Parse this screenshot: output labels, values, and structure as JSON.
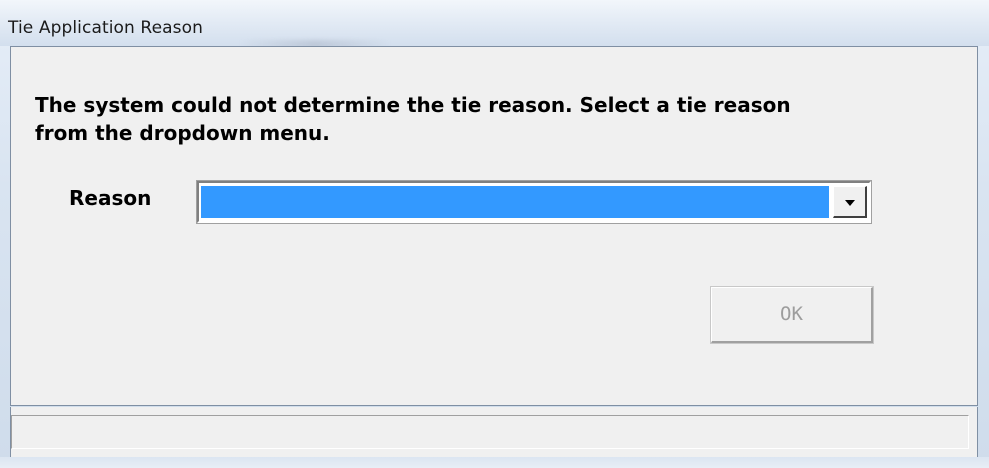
{
  "window": {
    "title": "Tie Application Reason"
  },
  "dialog": {
    "message": "The system could not determine the tie reason.  Select a tie reason\nfrom the dropdown menu.",
    "reason_label": "Reason",
    "reason_value": "",
    "ok_label": "OK",
    "ok_enabled": false
  },
  "statusbar": {
    "text": ""
  },
  "colors": {
    "selection": "#3399ff",
    "dialog_bg": "#f0f0f0",
    "disabled_text": "#9d9d9d"
  },
  "icons": {
    "dropdown": "chevron-down-icon"
  }
}
